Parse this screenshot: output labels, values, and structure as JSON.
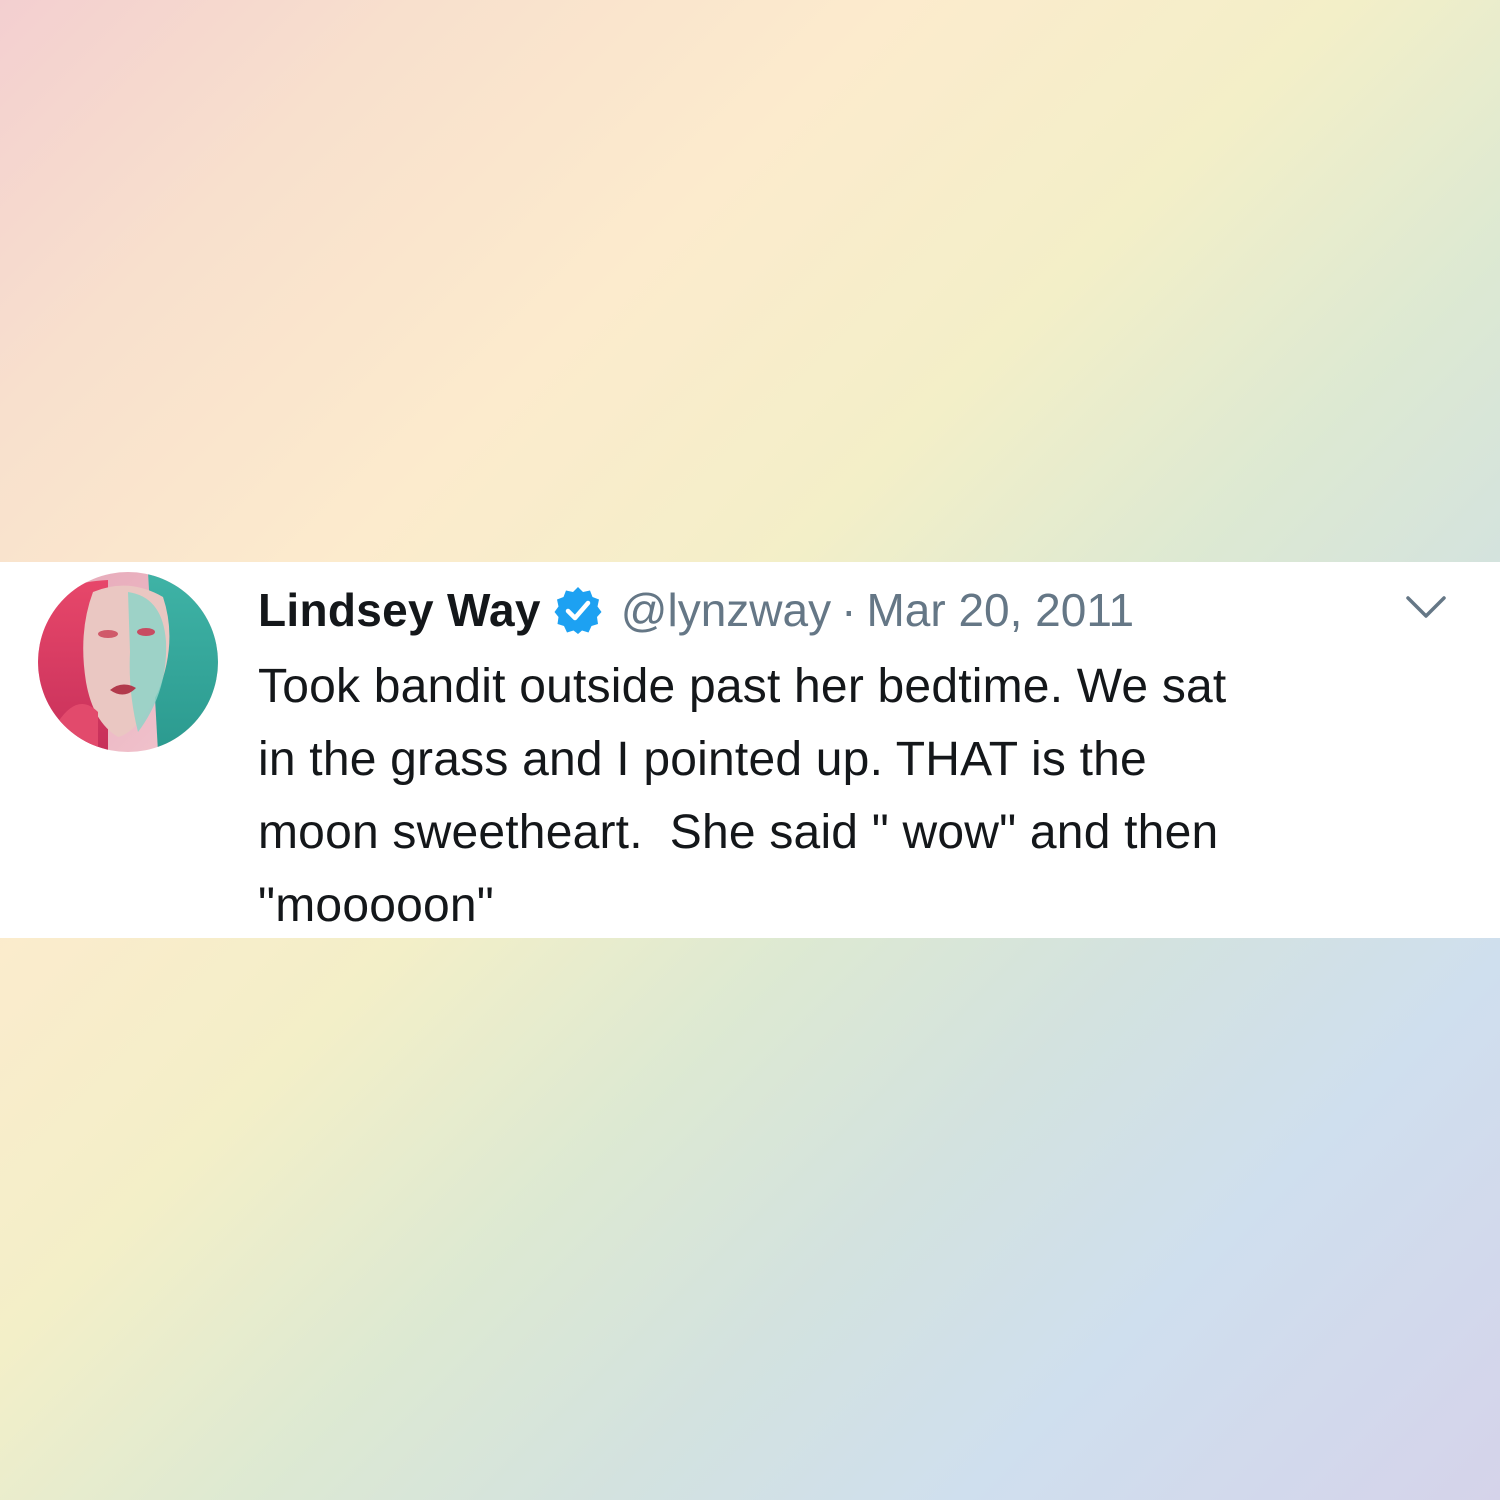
{
  "tweet": {
    "author": {
      "display_name": "Lindsey Way",
      "handle": "@lynzway",
      "verified": true,
      "avatar_icon": "profile-photo"
    },
    "separator": "·",
    "date": "Mar 20, 2011",
    "text_lines": [
      "Took bandit outside past her bedtime. We sat",
      "in the grass and I pointed up. THAT is the",
      "moon sweetheart.  She said \" wow\" and then",
      "\"mooooon\""
    ],
    "menu_icon": "chevron-down-icon"
  },
  "colors": {
    "verified_blue": "#1da1f2",
    "text_primary": "#14171a",
    "text_secondary": "#657786"
  }
}
